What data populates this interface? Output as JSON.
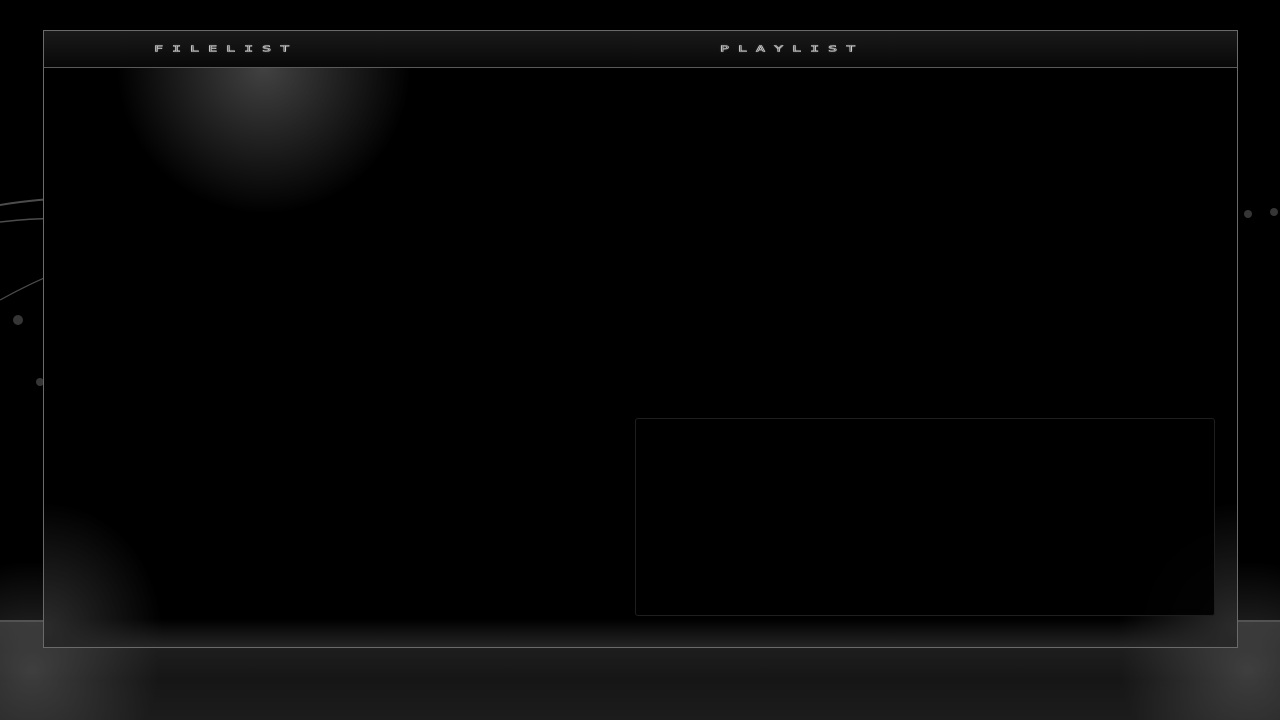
{
  "header": {
    "filelist_title": "FILELIST",
    "playlist_title": "PLAYLIST"
  },
  "icons": {
    "background": "woman-with-headphones-icon"
  },
  "colors": {
    "background": "#000000",
    "frame_border": "#6a6a6a",
    "title_outline": "#cfcfcf"
  }
}
